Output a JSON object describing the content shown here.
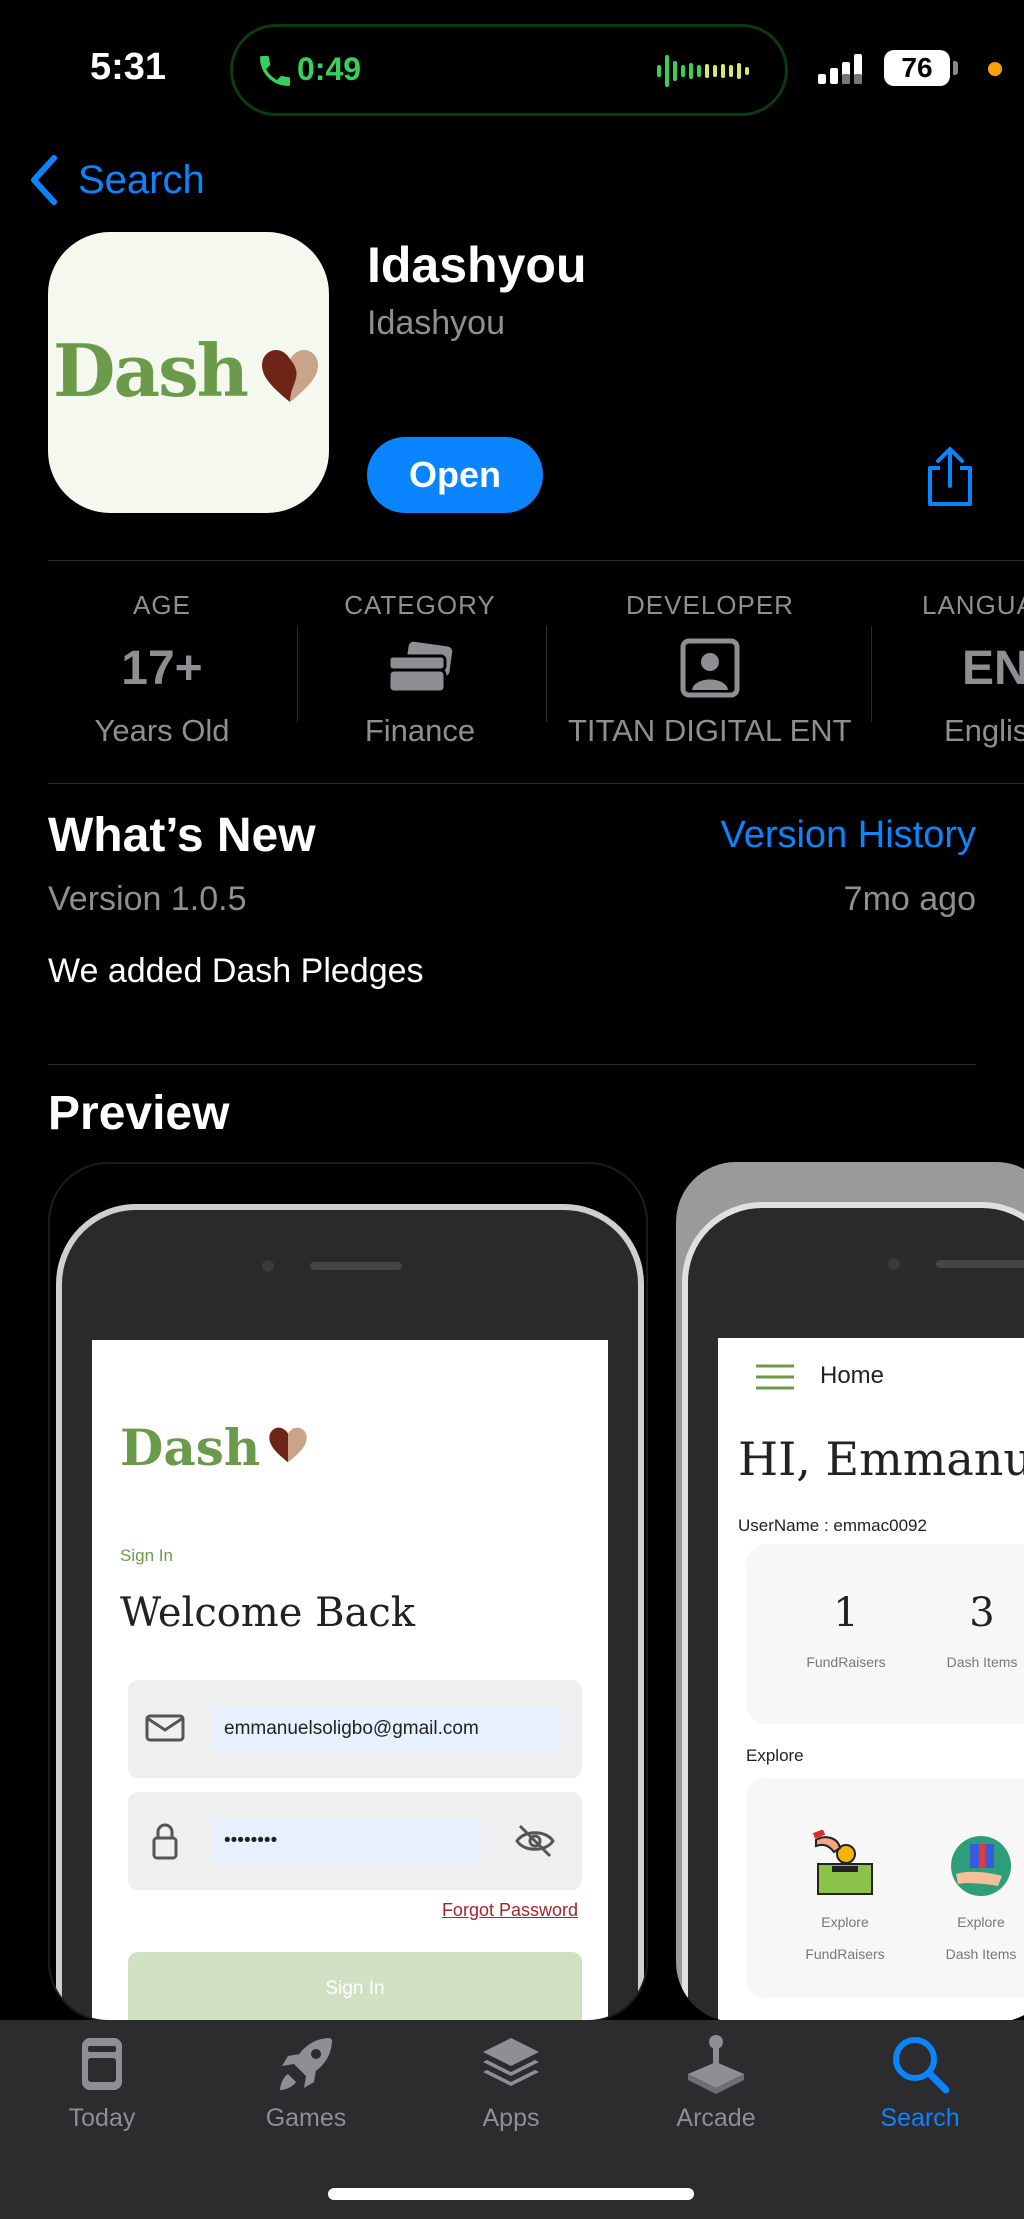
{
  "status_bar": {
    "time": "5:31",
    "call_duration": "0:49",
    "battery": "76",
    "call_color": "#35d15b",
    "indicator_color": "#ff9f0a"
  },
  "nav": {
    "back_label": "Search"
  },
  "app": {
    "name": "Idashyou",
    "developer": "Idashyou",
    "open_label": "Open",
    "icon_text": "Dash",
    "accent": "#0a84ff",
    "brand_green": "#6b9a4a"
  },
  "info": {
    "age": {
      "label": "AGE",
      "value": "17+",
      "sub": "Years Old"
    },
    "category": {
      "label": "CATEGORY",
      "icon": "wallet-icon",
      "sub": "Finance"
    },
    "developer": {
      "label": "DEVELOPER",
      "icon": "person-icon",
      "sub": "TITAN DIGITAL ENT"
    },
    "language": {
      "label": "LANGUA",
      "value": "EN",
      "sub": "Englis"
    }
  },
  "whats_new": {
    "title": "What’s New",
    "history_link": "Version History",
    "version": "Version 1.0.5",
    "ago": "7mo ago",
    "notes": "We added Dash Pledges"
  },
  "preview": {
    "title": "Preview",
    "screen1": {
      "logo": "Dash",
      "signin_small": "Sign In",
      "welcome": "Welcome Back",
      "email": "emmanuelsoligbo@gmail.com",
      "password": "••••••••",
      "forgot": "Forgot Password",
      "signin_button": "Sign In"
    },
    "screen2": {
      "header": "Home",
      "greeting": "HI, Emmanuel",
      "username": "UserName : emmac0092",
      "stats": [
        {
          "value": "1",
          "label": "FundRaisers"
        },
        {
          "value": "3",
          "label": "Dash Items"
        }
      ],
      "explore_title": "Explore",
      "explore": [
        {
          "line1": "Explore",
          "line2": "FundRaisers"
        },
        {
          "line1": "Explore",
          "line2": "Dash Items"
        }
      ]
    }
  },
  "tabs": [
    {
      "label": "Today",
      "icon": "today-icon"
    },
    {
      "label": "Games",
      "icon": "rocket-icon"
    },
    {
      "label": "Apps",
      "icon": "layers-icon"
    },
    {
      "label": "Arcade",
      "icon": "joystick-icon"
    },
    {
      "label": "Search",
      "icon": "search-icon",
      "active": true
    }
  ]
}
